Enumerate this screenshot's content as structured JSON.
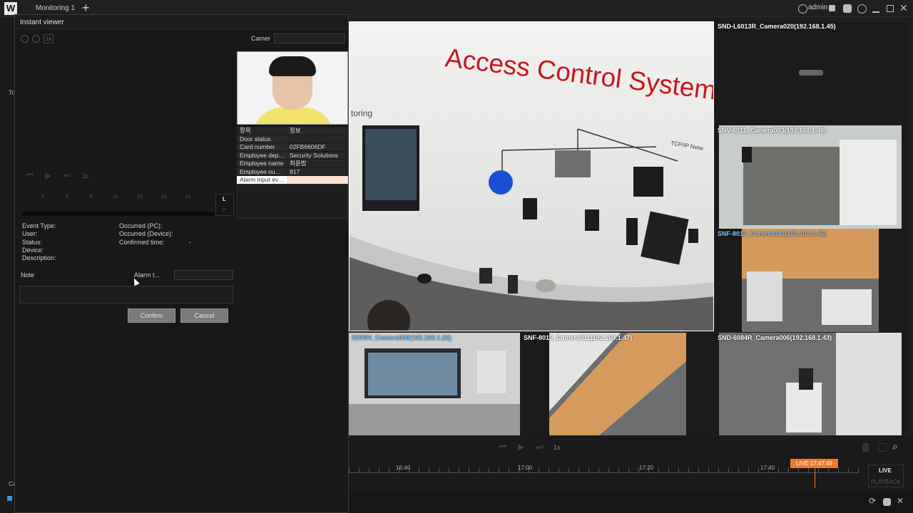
{
  "titlebar": {
    "logo": "W",
    "tab": "Monitoring 1",
    "add": "+",
    "user": "admin"
  },
  "left_under": {
    "label_a": "To",
    "label_b": "Ca"
  },
  "viewer": {
    "title": "Instant viewer",
    "zoom_level": "1x",
    "camera_label": "Camer",
    "playback_speed": "1x",
    "timeline_ticks": [
      "3",
      "6",
      "9",
      "12",
      "15",
      "18",
      "21"
    ],
    "lr_top": "L",
    "lr_bottom": "P",
    "table": {
      "headers": [
        "항목",
        "정보"
      ],
      "rows": [
        [
          "Door status",
          ""
        ],
        [
          "Card number",
          "02FB6606DF"
        ],
        [
          "Employee dep…",
          "Security Solutions"
        ],
        [
          "Employee name",
          "최윤범"
        ],
        [
          "Employee nu…",
          "917"
        ],
        [
          "Alarm input ev…",
          ""
        ]
      ]
    },
    "event_type_label": "Event Type:",
    "user_label": "User:",
    "status_label": "Status:",
    "device_label": "Device:",
    "description_label": "Description:",
    "occurred_pc_label": "Occurred (PC):",
    "occurred_device_label": "Occurred (Device):",
    "confirmed_time_label": "Confirmed time:",
    "confirmed_time_value": "-",
    "note_label": "Note",
    "alarm_type_label": "Alarm t...",
    "confirm_button": "Confirm",
    "cancel_button": "Cancel"
  },
  "main_video": {
    "sign": "Access Control System",
    "sub": "toring",
    "tcp": "TCP/IP Netw"
  },
  "cameras": [
    {
      "label": "SND-L6013R_Camera020(192.168.1.45)"
    },
    {
      "label": "SNV-6011_Camera003(192.168.1.48)"
    },
    {
      "label": "SNF-8010_Camera012(192.168.1.46)"
    },
    {
      "label": "320RH_Camera008(192.168.1.22)"
    },
    {
      "label": "SNF-8010_Camera011(192.168.1.47)"
    },
    {
      "label": "SND-6084R_Camera006(192.168.1.43)"
    }
  ],
  "playback": {
    "speed": "1x"
  },
  "timeline": {
    "times": [
      "16:40",
      "17:00",
      "17:20",
      "17:40"
    ],
    "live_time": "LIVE 17:47:49",
    "live": "LIVE",
    "playback": "PLAYBACK"
  },
  "colors": {
    "accent": "#f07a2a",
    "highlight_label": "#7fc4ff"
  }
}
